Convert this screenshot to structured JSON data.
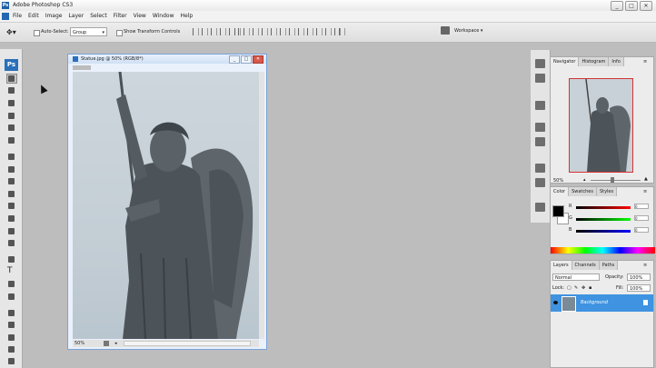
{
  "window": {
    "title": "Adobe Photoshop CS3",
    "app_icon": "photoshop-icon",
    "minimize": "_",
    "maximize": "□",
    "close": "✕"
  },
  "menu": [
    "File",
    "Edit",
    "Image",
    "Layer",
    "Select",
    "Filter",
    "View",
    "Window",
    "Help"
  ],
  "options": {
    "auto_select_label": "Auto-Select:",
    "group_value": "Group",
    "show_transform_label": "Show Transform Controls",
    "workspace_label": "Workspace ▾"
  },
  "toolbox": {
    "logo": "Ps"
  },
  "document": {
    "title": "Statue.jpg @ 50% (RGB/8*)",
    "zoom": "50%",
    "minimize": "_",
    "restore": "□",
    "close": "✕",
    "status_arrow": "◂"
  },
  "navigator": {
    "tabs": [
      "Navigator",
      "Histogram",
      "Info"
    ],
    "zoom": "50%",
    "zoom_level": 0.5
  },
  "color": {
    "tabs": [
      "Color",
      "Swatches",
      "Styles"
    ],
    "channels": [
      "R",
      "G",
      "B"
    ],
    "values": [
      "0",
      "0",
      "0"
    ],
    "foreground": "#000000",
    "background": "#ffffff"
  },
  "layers": {
    "tabs": [
      "Layers",
      "Channels",
      "Paths"
    ],
    "blend_mode": "Normal",
    "opacity_label": "Opacity:",
    "opacity": "100%",
    "lock_label": "Lock:",
    "fill_label": "Fill:",
    "fill": "100%",
    "layer_name": "Background"
  },
  "colors": {
    "accent": "#3f93e0",
    "ps_blue": "#2a6fba",
    "selection_red": "#d43333"
  }
}
